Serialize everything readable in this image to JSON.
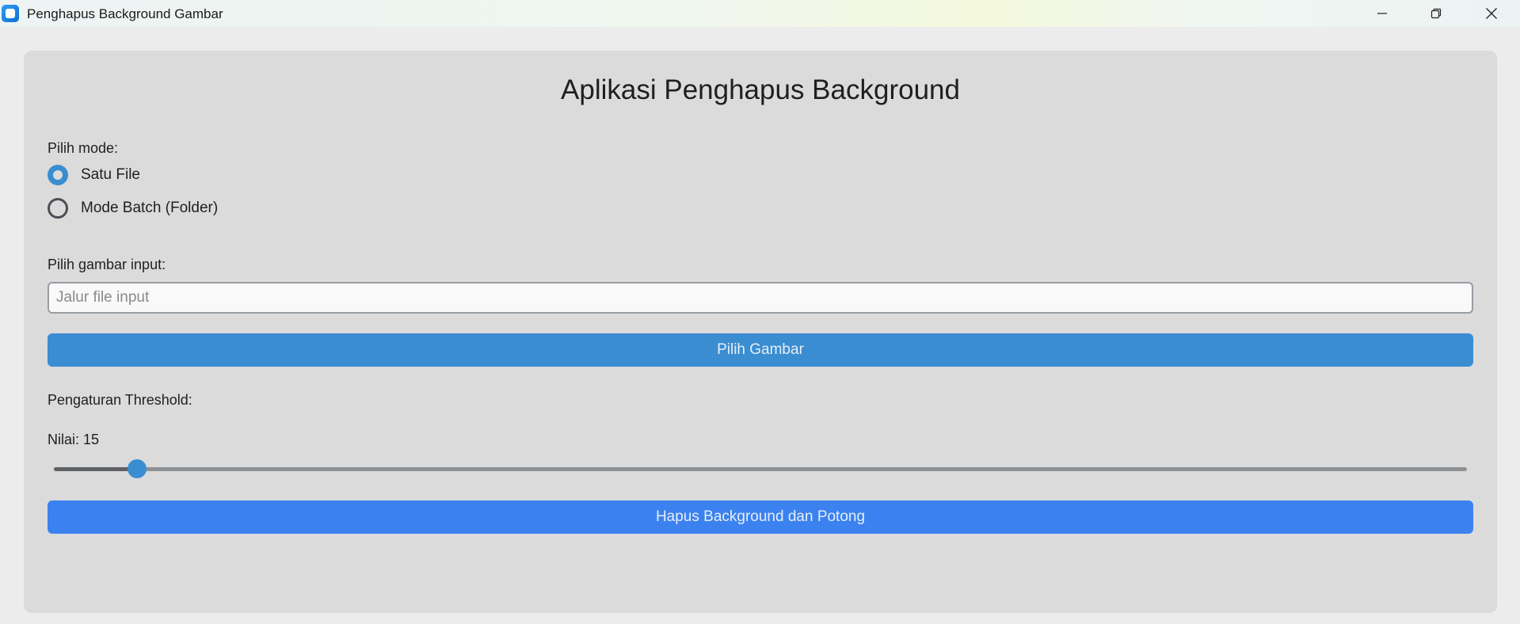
{
  "window": {
    "title": "Penghapus Background Gambar",
    "app_icon": "app-icon",
    "controls": [
      "minimize-icon",
      "restore-icon",
      "close-icon"
    ]
  },
  "main": {
    "heading": "Aplikasi Penghapus Background",
    "mode_label": "Pilih mode:",
    "modes": [
      {
        "label": "Satu File",
        "checked": true
      },
      {
        "label": "Mode Batch (Folder)",
        "checked": false
      }
    ],
    "input_label": "Pilih gambar input:",
    "input": {
      "value": "",
      "placeholder": "Jalur file input"
    },
    "pick_button": "Pilih Gambar",
    "threshold_label": "Pengaturan Threshold:",
    "value_label": "Nilai: 15",
    "slider": {
      "value": 15,
      "min": 0,
      "max": 255
    },
    "remove_button": "Hapus Background dan Potong"
  },
  "colors": {
    "accent": "#3a8dd1",
    "action": "#3b82f0",
    "panel": "#dbdbdb",
    "window": "#ececec"
  }
}
